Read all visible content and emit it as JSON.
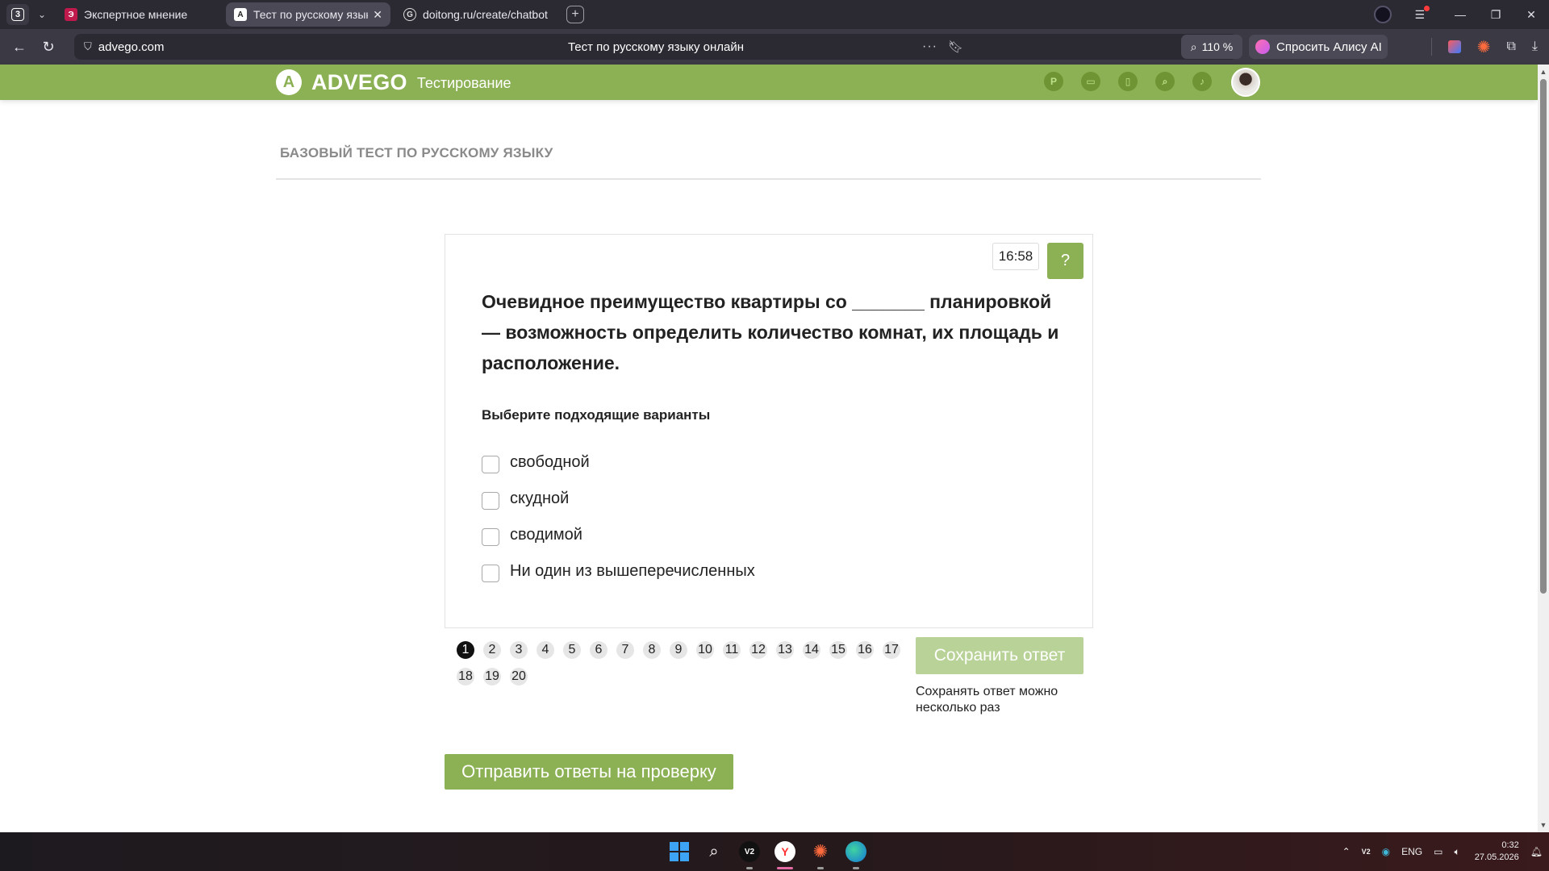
{
  "browser": {
    "tab_count": "3",
    "tabs": [
      {
        "title": "Экспертное мнение",
        "favicon": "dzen-icon"
      },
      {
        "title": "Тест по русскому язык",
        "favicon": "advego-icon"
      },
      {
        "title": "doitong.ru/create/chatbot",
        "favicon": "globe-icon"
      }
    ],
    "url_host": "advego.com",
    "page_title": "Тест по русскому языку онлайн",
    "zoom": "110 %",
    "alice_label": "Спросить Алису AI"
  },
  "site": {
    "brand": "ADVEGO",
    "section": "Тестирование",
    "header_icons": [
      "P",
      "chat-icon",
      "bookmark-icon",
      "search-icon",
      "bell-icon"
    ],
    "accent_color": "#8cb054"
  },
  "test": {
    "title": "БАЗОВЫЙ ТЕСТ ПО РУССКОМУ ЯЗЫКУ",
    "timer": "16:58",
    "help_label": "?",
    "question": "Очевидное преимущество квартиры со _______ планировкой — возможность определить количество комнат, их площадь и расположение.",
    "hint": "Выберите подходящие варианты",
    "options": [
      "свободной",
      "скудной",
      "сводимой",
      "Ни один из вышеперечисленных"
    ],
    "pages": [
      "1",
      "2",
      "3",
      "4",
      "5",
      "6",
      "7",
      "8",
      "9",
      "10",
      "11",
      "12",
      "13",
      "14",
      "15",
      "16",
      "17",
      "18",
      "19",
      "20"
    ],
    "current_page": "1",
    "save_label": "Сохранить ответ",
    "save_note": "Сохранять ответ можно несколько раз",
    "submit_label": "Отправить ответы на проверку"
  },
  "taskbar": {
    "lang": "ENG",
    "time": "0:32",
    "date": "27.05.2026"
  }
}
